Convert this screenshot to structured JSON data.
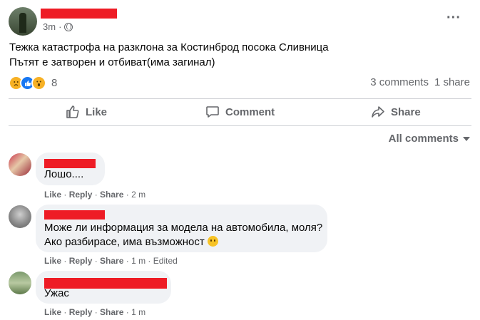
{
  "post": {
    "time": "3m",
    "more_label": "···",
    "text_line1": "Тежка катастрофа на разклона за Костинброд посока Сливница",
    "text_line2": "Пътят е затворен и отбиват(има загинал)",
    "reaction_count": "8",
    "comments_count": "3 comments",
    "shares_count": "1 share",
    "reaction_icons": [
      "sad-reaction-icon",
      "like-reaction-icon",
      "wow-reaction-icon"
    ]
  },
  "actions": {
    "like": "Like",
    "comment": "Comment",
    "share": "Share"
  },
  "filter": {
    "label": "All comments"
  },
  "comments": [
    {
      "text": "Лошо....",
      "like": "Like",
      "reply": "Reply",
      "share": "Share",
      "time": "2 m",
      "edited": ""
    },
    {
      "text_line1": "Може ли информация за модела на автомобила, моля?",
      "text_line2": "Ако разбирасе, има възможност",
      "like": "Like",
      "reply": "Reply",
      "share": "Share",
      "time": "1 m",
      "edited": "Edited"
    },
    {
      "text": "Ужас",
      "like": "Like",
      "reply": "Reply",
      "share": "Share",
      "time": "1 m",
      "edited": ""
    }
  ],
  "colors": {
    "accent": "#1877f2",
    "secondary_text": "#65676b",
    "bubble": "#f0f2f5",
    "redaction": "#ee1c25"
  }
}
